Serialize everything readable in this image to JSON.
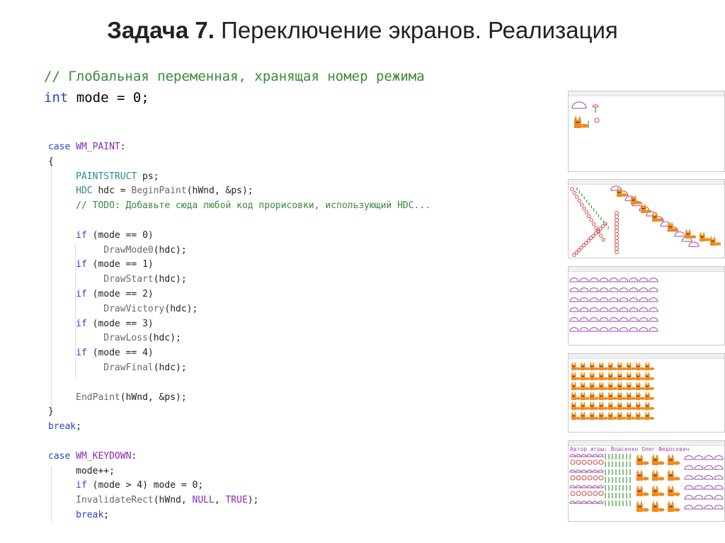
{
  "slide": {
    "title_bold": "Задача 7.",
    "title_rest": " Переключение экранов. Реализация"
  },
  "global_code": {
    "comment": "// Глобальная переменная, хранящая номер режима",
    "kw": "int",
    "rest": " mode = 0;"
  },
  "code": {
    "case1": "case",
    "wm_paint": "WM_PAINT",
    "colon": ":",
    "open_brace": "{",
    "paintstruct": "PAINTSTRUCT",
    "ps_decl": " ps;",
    "hdc_type": "HDC",
    "hdc_assign": " hdc = ",
    "beginpaint": "BeginPaint",
    "bp_args": "(hWnd, &ps);",
    "todo": "// TODO: Добавьте сюда любой код прорисовки, использующий HDC...",
    "if": "if",
    "cond0": " (mode == 0)",
    "cond1": " (mode == 1)",
    "cond2": " (mode == 2)",
    "cond3": " (mode == 3)",
    "cond4": " (mode == 4)",
    "draw0": "DrawMode0",
    "draw1": "DrawStart",
    "draw2": "DrawVictory",
    "draw3": "DrawLoss",
    "draw4": "DrawFinal",
    "hdc_call": "(hdc);",
    "endpaint": "EndPaint",
    "ep_args": "(hWnd, &ps);",
    "close_brace": "}",
    "break": "break",
    "semi": ";",
    "case2": "case",
    "wm_keydown": "WM_KEYDOWN",
    "mode_inc": "mode++;",
    "cond_gt": " (mode > 4) mode = 0;",
    "invalidate": "InvalidateRect",
    "inv_open": "(hWnd, ",
    "null": "NULL",
    "comma": ", ",
    "true": "TRUE",
    "inv_close": ");"
  },
  "thumbnails": {
    "author_text": "Автор игры: Власенко Олег Федосович"
  },
  "colors": {
    "keyword": "#2a44c8",
    "macro": "#8a2ab8",
    "type": "#2a8a8a",
    "comment": "#3a8a3a",
    "dome": "#9a4aa8",
    "fox": "#f08a1e",
    "ring": "#d04848",
    "green": "#3a9a3a"
  }
}
